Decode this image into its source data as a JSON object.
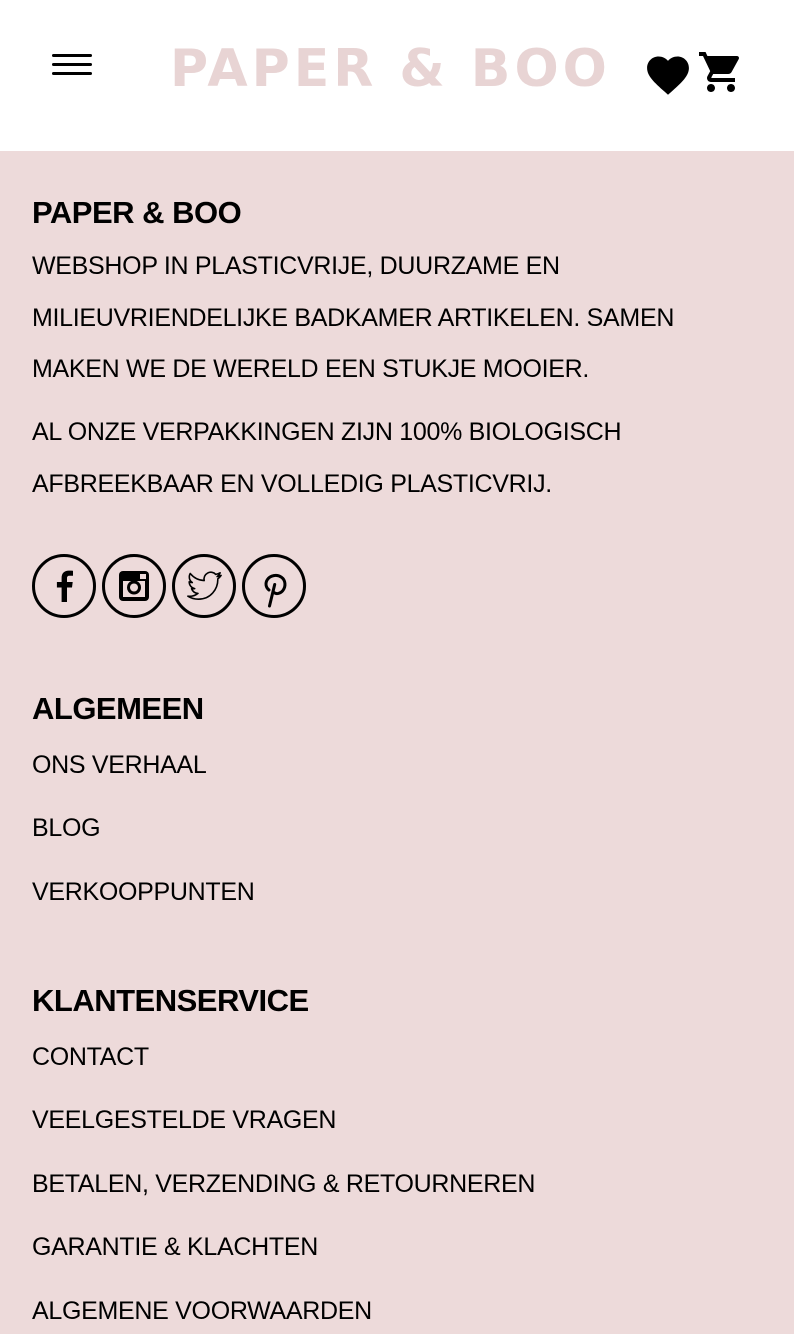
{
  "header": {
    "logo_text": "PAPER & BOO",
    "menu_icon": "hamburger-menu-icon",
    "wishlist_icon": "heart-icon",
    "cart_icon": "shopping-cart-icon",
    "logo_color": "#e8d4d4"
  },
  "footer": {
    "background": "#eddada",
    "about": {
      "title": "PAPER & BOO",
      "paragraphs": [
        "WEBSHOP IN PLASTICVRIJE, DUURZAME EN MILIEUVRIENDELIJKE BADKAMER ARTIKELEN. SAMEN MAKEN WE DE WERELD EEN STUKJE MOOIER.",
        "AL ONZE VERPAKKINGEN ZIJN 100% BIOLOGISCH AFBREEKBAAR EN VOLLEDIG PLASTICVRIJ."
      ]
    },
    "social": [
      {
        "icon": "facebook-icon"
      },
      {
        "icon": "instagram-icon"
      },
      {
        "icon": "twitter-icon"
      },
      {
        "icon": "pinterest-icon"
      }
    ],
    "general": {
      "title": "ALGEMEEN",
      "links": [
        "ONS VERHAAL",
        "BLOG",
        "VERKOOPPUNTEN"
      ]
    },
    "service": {
      "title": "KLANTENSERVICE",
      "links": [
        "CONTACT",
        "VEELGESTELDE VRAGEN",
        "BETALEN, VERZENDING & RETOURNEREN",
        "GARANTIE & KLACHTEN",
        "ALGEMENE VOORWAARDEN"
      ]
    }
  }
}
